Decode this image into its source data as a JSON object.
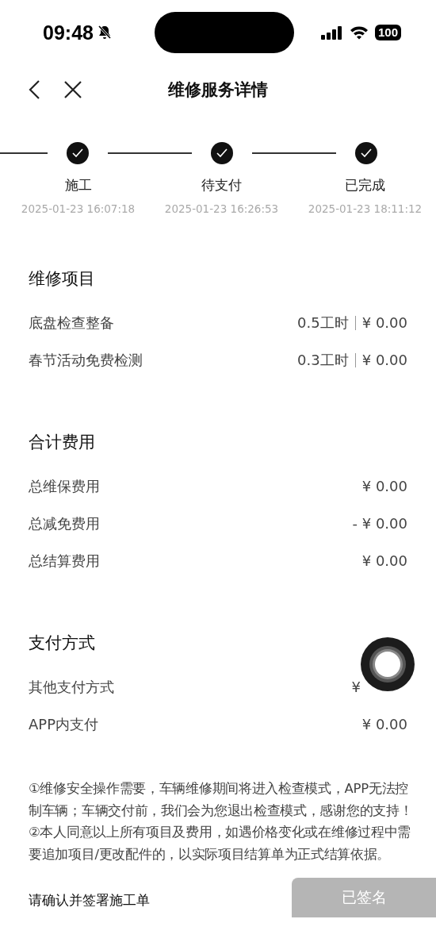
{
  "status_bar": {
    "time": "09:48",
    "silenced": true,
    "battery": "100"
  },
  "nav": {
    "title": "维修服务详情"
  },
  "steps": [
    {
      "label": "施工",
      "time": "2025-01-23 16:07:18",
      "done": true
    },
    {
      "label": "待支付",
      "time": "2025-01-23 16:26:53",
      "done": true
    },
    {
      "label": "已完成",
      "time": "2025-01-23 18:11:12",
      "done": true
    }
  ],
  "sections": [
    {
      "title": "维修项目",
      "rows": [
        {
          "label": "底盘检查整备",
          "hours": "0.5工时",
          "value": "¥ 0.00"
        },
        {
          "label": "春节活动免费检测",
          "hours": "0.3工时",
          "value": "¥ 0.00"
        }
      ]
    },
    {
      "title": "合计费用",
      "rows": [
        {
          "label": "总维保费用",
          "value": "¥ 0.00"
        },
        {
          "label": "总减免费用",
          "value": "- ¥ 0.00"
        },
        {
          "label": "总结算费用",
          "value": "¥ 0.00"
        }
      ]
    },
    {
      "title": "支付方式",
      "rows": [
        {
          "label": "其他支付方式",
          "value": "¥",
          "covered": true
        },
        {
          "label": "APP内支付",
          "value": "¥ 0.00"
        }
      ]
    }
  ],
  "notes": [
    "①维修安全操作需要，车辆维修期间将进入检查模式，APP无法控制车辆；车辆交付前，我们会为您退出检查模式，感谢您的支持！",
    "②本人同意以上所有项目及费用，如遇价格变化或在维修过程中需要追加项目/更改配件的，以实际项目结算单为正式结算依据。"
  ],
  "footer": {
    "prompt": "请确认并签署施工单",
    "button": "已签名",
    "disabled": true
  }
}
